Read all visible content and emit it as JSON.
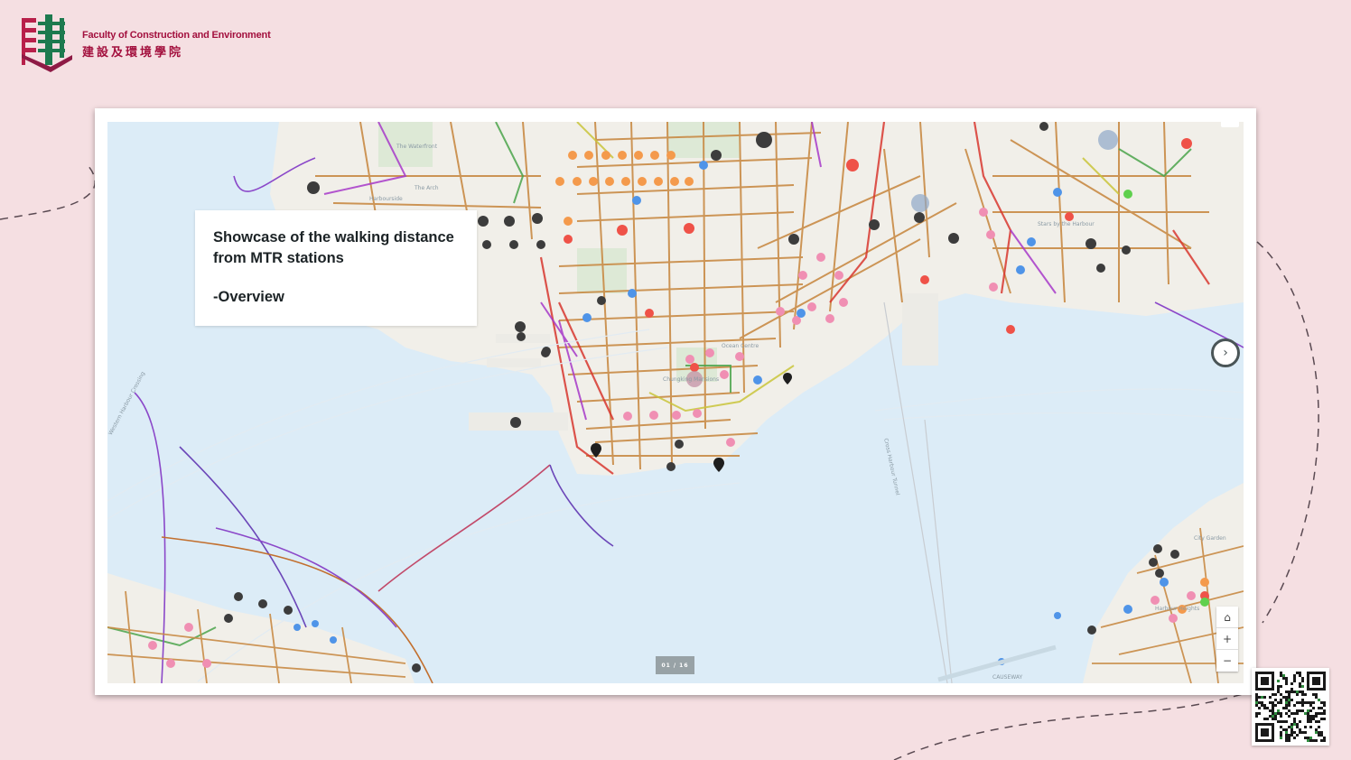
{
  "logo": {
    "name_en": "Faculty of Construction and Environment",
    "name_zh": "建設及環境學院"
  },
  "info_panel": {
    "title": "Showcase of the walking distance from MTR stations",
    "subtitle": "-Overview"
  },
  "pager": {
    "indicator": "01 / 16"
  },
  "controls": {
    "next_icon": "›",
    "home_icon": "⌂",
    "zoom_in": "+",
    "zoom_out": "−"
  },
  "map_labels": {
    "harbourside": "Harbourside",
    "the_arch": "The Arch",
    "waterfront": "The Waterfront",
    "cross_harbour_tunnel": "Cross Harbour Tunnel",
    "western_harbour_crossing": "Western Harbour Crossing",
    "causeway": "CAUSEWAY",
    "city_garden": "City Garden",
    "harbour_heights": "Harbour Heights",
    "ocean_centre": "Ocean Centre",
    "chungking_mansions": "Chungking Mansions",
    "stars_by_the_harbour": "Stars by the Harbour"
  },
  "colors": {
    "background": "#f5dfe2",
    "brand": "#a3103e",
    "water": "#dcecf7",
    "land": "#f1efe9"
  }
}
